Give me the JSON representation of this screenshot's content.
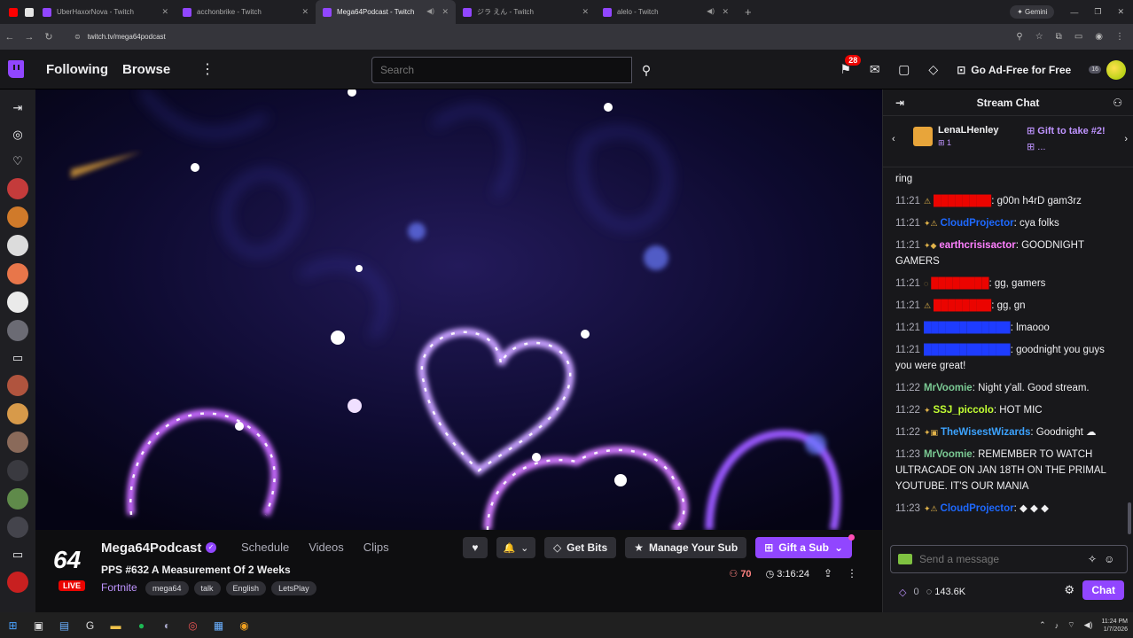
{
  "browser": {
    "tabs": [
      {
        "title": "UberHaxorNova - Twitch",
        "active": false,
        "sound": false
      },
      {
        "title": "acchonbrike - Twitch",
        "active": false,
        "sound": false
      },
      {
        "title": "Mega64Podcast - Twitch",
        "active": true,
        "sound": true
      },
      {
        "title": "ジラ えん - Twitch",
        "active": false,
        "sound": false
      },
      {
        "title": "alelo - Twitch",
        "active": false,
        "sound": true
      }
    ],
    "new_tab": "+",
    "gemini": "Gemini",
    "url": "twitch.tv/mega64podcast"
  },
  "topnav": {
    "following": "Following",
    "browse": "Browse",
    "more": "⋮",
    "search_placeholder": "Search",
    "notif_count": "28",
    "ad_free": "Go Ad-Free for Free",
    "avatar_badge": "16"
  },
  "channel": {
    "name": "Mega64Podcast",
    "logo_text": "64",
    "live": "LIVE",
    "links": [
      "Schedule",
      "Videos",
      "Clips"
    ],
    "title": "PPS #632 A Measurement Of 2 Weeks",
    "game": "Fortnite",
    "tags": [
      "mega64",
      "talk",
      "English",
      "LetsPlay"
    ],
    "viewers": "70",
    "uptime": "3:16:24",
    "get_bits": "Get Bits",
    "manage_sub": "Manage Your Sub",
    "gift_sub": "Gift a Sub"
  },
  "chat": {
    "header": "Stream Chat",
    "gift_user": "LenaLHenley",
    "gift_count": "1",
    "gift_take": "Gift to take #2!",
    "gift_more": "...",
    "messages": [
      {
        "time": "",
        "badges": "",
        "user": "",
        "color": "#efeff1",
        "text": "ring"
      },
      {
        "time": "11:21",
        "badges": "⚠",
        "user": "████████",
        "color": "#eb0400",
        "text": ": g00n h4rD gam3rz"
      },
      {
        "time": "11:21",
        "badges": "✦⚠",
        "user": "CloudProjector",
        "color": "#1e69ff",
        "text": ": cya folks"
      },
      {
        "time": "11:21",
        "badges": "✦◆",
        "user": "earthcrisisactor",
        "color": "#ff80ff",
        "text": ": GOODNIGHT GAMERS"
      },
      {
        "time": "11:21",
        "badges": "◌",
        "user": "████████",
        "color": "#eb0400",
        "text": ": gg, gamers"
      },
      {
        "time": "11:21",
        "badges": "⚠",
        "user": "████████",
        "color": "#eb0400",
        "text": ": gg, gn"
      },
      {
        "time": "11:21",
        "badges": "",
        "user": "████████████",
        "color": "#1e3cff",
        "text": ": lmaooo"
      },
      {
        "time": "11:21",
        "badges": "",
        "user": "████████████",
        "color": "#1e3cff",
        "text": ": goodnight you guys you were great!"
      },
      {
        "time": "11:22",
        "badges": "",
        "user": "MrVoomie",
        "color": "#7ac993",
        "text": ": Night y'all. Good stream."
      },
      {
        "time": "11:22",
        "badges": "✦",
        "user": "SSJ_piccolo",
        "color": "#c2ff33",
        "text": ": HOT MIC"
      },
      {
        "time": "11:22",
        "badges": "✦▣",
        "user": "TheWisestWizards",
        "color": "#3ca3ff",
        "text": ": Goodnight ☁"
      },
      {
        "time": "11:23",
        "badges": "",
        "user": "MrVoomie",
        "color": "#7ac993",
        "text": ": REMEMBER TO WATCH ULTRACADE ON JAN 18TH ON THE PRIMAL YOUTUBE. IT'S OUR MANIA"
      },
      {
        "time": "11:23",
        "badges": "✦⚠",
        "user": "CloudProjector",
        "color": "#1e69ff",
        "text": ": ◆ ◆ ◆"
      }
    ],
    "input_placeholder": "Send a message",
    "points_a": "0",
    "points_b": "143.6K",
    "chat_button": "Chat"
  },
  "taskbar": {
    "time": "11:24 PM",
    "date": "1/7/2026"
  }
}
